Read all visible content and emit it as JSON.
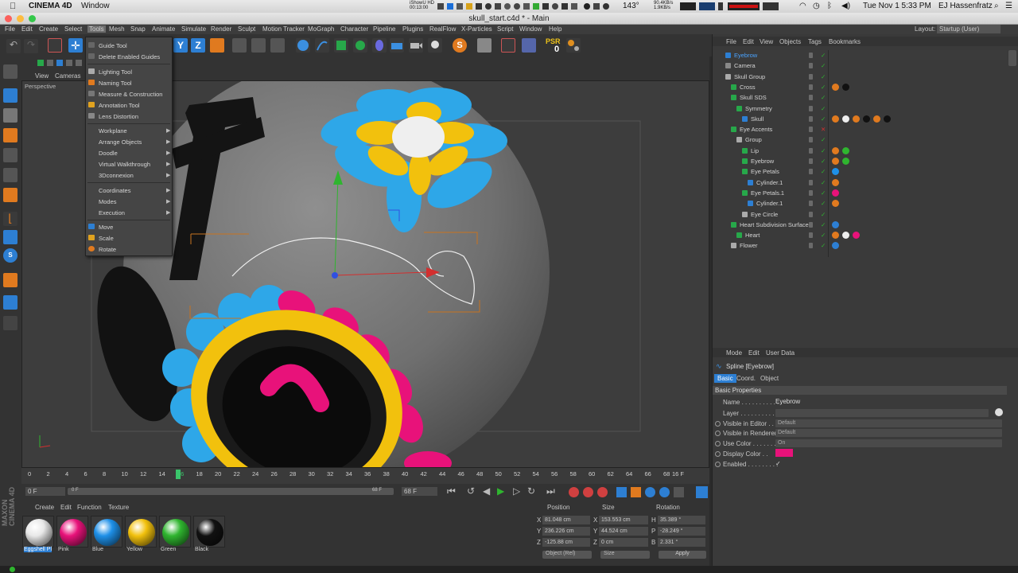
{
  "macos": {
    "apple": "",
    "app_name": "CINEMA 4D",
    "menu_window": "Window",
    "istat": "iShowU HD\n00:13:00",
    "battery": "143°",
    "net": "90.4KB/s\n1.9KB/s",
    "datetime": "Tue Nov 1  5:33 PM",
    "user": "EJ Hassenfratz"
  },
  "window_title": "skull_start.c4d * - Main",
  "menu": [
    "File",
    "Edit",
    "Create",
    "Select",
    "Tools",
    "Mesh",
    "Snap",
    "Animate",
    "Simulate",
    "Render",
    "Sculpt",
    "Motion Tracker",
    "MoGraph",
    "Character",
    "Pipeline",
    "Plugins",
    "RealFlow",
    "X-Particles",
    "Script",
    "Window",
    "Help"
  ],
  "layout": {
    "label": "Layout:",
    "value": "Startup (User)"
  },
  "tools_menu": {
    "group1": [
      "Guide Tool",
      "Delete Enabled Guides"
    ],
    "group2": [
      "Lighting Tool",
      "Naming Tool",
      "Measure & Construction",
      "Annotation Tool",
      "Lens Distortion"
    ],
    "group3": [
      "Workplane",
      "Arrange Objects",
      "Doodle",
      "Virtual Walkthrough",
      "3Dconnexion"
    ],
    "group4": [
      "Coordinates",
      "Modes",
      "Execution"
    ],
    "group5": [
      "Move",
      "Scale",
      "Rotate"
    ]
  },
  "viewport": {
    "menu": [
      "View",
      "Cameras"
    ],
    "label": "Perspective"
  },
  "toolbar_psr": {
    "label": "PSR",
    "value": "0"
  },
  "object_manager": {
    "menu": [
      "File",
      "Edit",
      "View",
      "Objects",
      "Tags",
      "Bookmarks"
    ],
    "items": [
      {
        "name": "Eyebrow",
        "depth": 0,
        "selected": true
      },
      {
        "name": "Camera",
        "depth": 0
      },
      {
        "name": "Skull Group",
        "depth": 0
      },
      {
        "name": "Cross",
        "depth": 1
      },
      {
        "name": "Skull SDS",
        "depth": 1
      },
      {
        "name": "Symmetry",
        "depth": 2
      },
      {
        "name": "Skull",
        "depth": 3
      },
      {
        "name": "Eye Accents",
        "depth": 1
      },
      {
        "name": "Group",
        "depth": 2
      },
      {
        "name": "Lip",
        "depth": 3
      },
      {
        "name": "Eyebrow",
        "depth": 3
      },
      {
        "name": "Eye Petals",
        "depth": 3
      },
      {
        "name": "Cylinder.1",
        "depth": 4
      },
      {
        "name": "Eye Petals.1",
        "depth": 3
      },
      {
        "name": "Cylinder.1",
        "depth": 4
      },
      {
        "name": "Eye Circle",
        "depth": 3
      },
      {
        "name": "Heart Subdivision Surface",
        "depth": 1
      },
      {
        "name": "Heart",
        "depth": 2
      },
      {
        "name": "Flower",
        "depth": 1
      }
    ]
  },
  "attributes": {
    "menu": [
      "Mode",
      "Edit",
      "User Data"
    ],
    "title": "Spline [Eyebrow]",
    "tabs": [
      "Basic",
      "Coord.",
      "Object"
    ],
    "section": "Basic Properties",
    "rows": [
      {
        "label": "Name . . . . . . . . . . . .",
        "value": "Eyebrow"
      },
      {
        "label": "Layer . . . . . . . . . . . .",
        "value": ""
      },
      {
        "label": "Visible in Editor . .",
        "value": "Default"
      },
      {
        "label": "Visible in Renderer",
        "value": "Default"
      },
      {
        "label": "Use Color . . . . . . . .",
        "value": "On"
      },
      {
        "label": "Display Color . .",
        "value": ""
      },
      {
        "label": "Enabled . . . . . . . . .",
        "value": "✓"
      }
    ],
    "display_color": "#e8127a"
  },
  "timeline": {
    "ticks": [
      "0",
      "2",
      "4",
      "6",
      "8",
      "10",
      "12",
      "14",
      "16",
      "18",
      "20",
      "22",
      "24",
      "26",
      "28",
      "30",
      "32",
      "34",
      "36",
      "38",
      "40",
      "42",
      "44",
      "46",
      "48",
      "50",
      "52",
      "54",
      "56",
      "58",
      "60",
      "62",
      "64",
      "66",
      "68"
    ],
    "current": "16",
    "end_label": "16 F",
    "start_field": "0 F",
    "range_start": "0 F",
    "range_end": "68 F",
    "end_field": "68 F"
  },
  "materials": {
    "menu": [
      "Create",
      "Edit",
      "Function",
      "Texture"
    ],
    "items": [
      {
        "name": "Eggshell Pl",
        "color": "#e8e8e8"
      },
      {
        "name": "Pink",
        "color": "#e8127a"
      },
      {
        "name": "Blue",
        "color": "#1e90e8"
      },
      {
        "name": "Yellow",
        "color": "#f2c10d"
      },
      {
        "name": "Green",
        "color": "#2fb52f"
      },
      {
        "name": "Black",
        "color": "#111111"
      }
    ]
  },
  "coordinates": {
    "headers": [
      "Position",
      "Size",
      "Rotation"
    ],
    "rows": [
      {
        "axis": "X",
        "pos": "81.048 cm",
        "s_axis": "X",
        "size": "153.553 cm",
        "r_axis": "H",
        "rot": "35.389 °"
      },
      {
        "axis": "Y",
        "pos": "236.226 cm",
        "s_axis": "Y",
        "size": "44.524 cm",
        "r_axis": "P",
        "rot": "-28.249 °"
      },
      {
        "axis": "Z",
        "pos": "-125.88 cm",
        "s_axis": "Z",
        "size": "0 cm",
        "r_axis": "B",
        "rot": "2.331 °"
      }
    ],
    "mode": "Object (Rel)",
    "size_mode": "Size",
    "apply": "Apply"
  },
  "maxon": "MAXON\nCINEMA 4D"
}
